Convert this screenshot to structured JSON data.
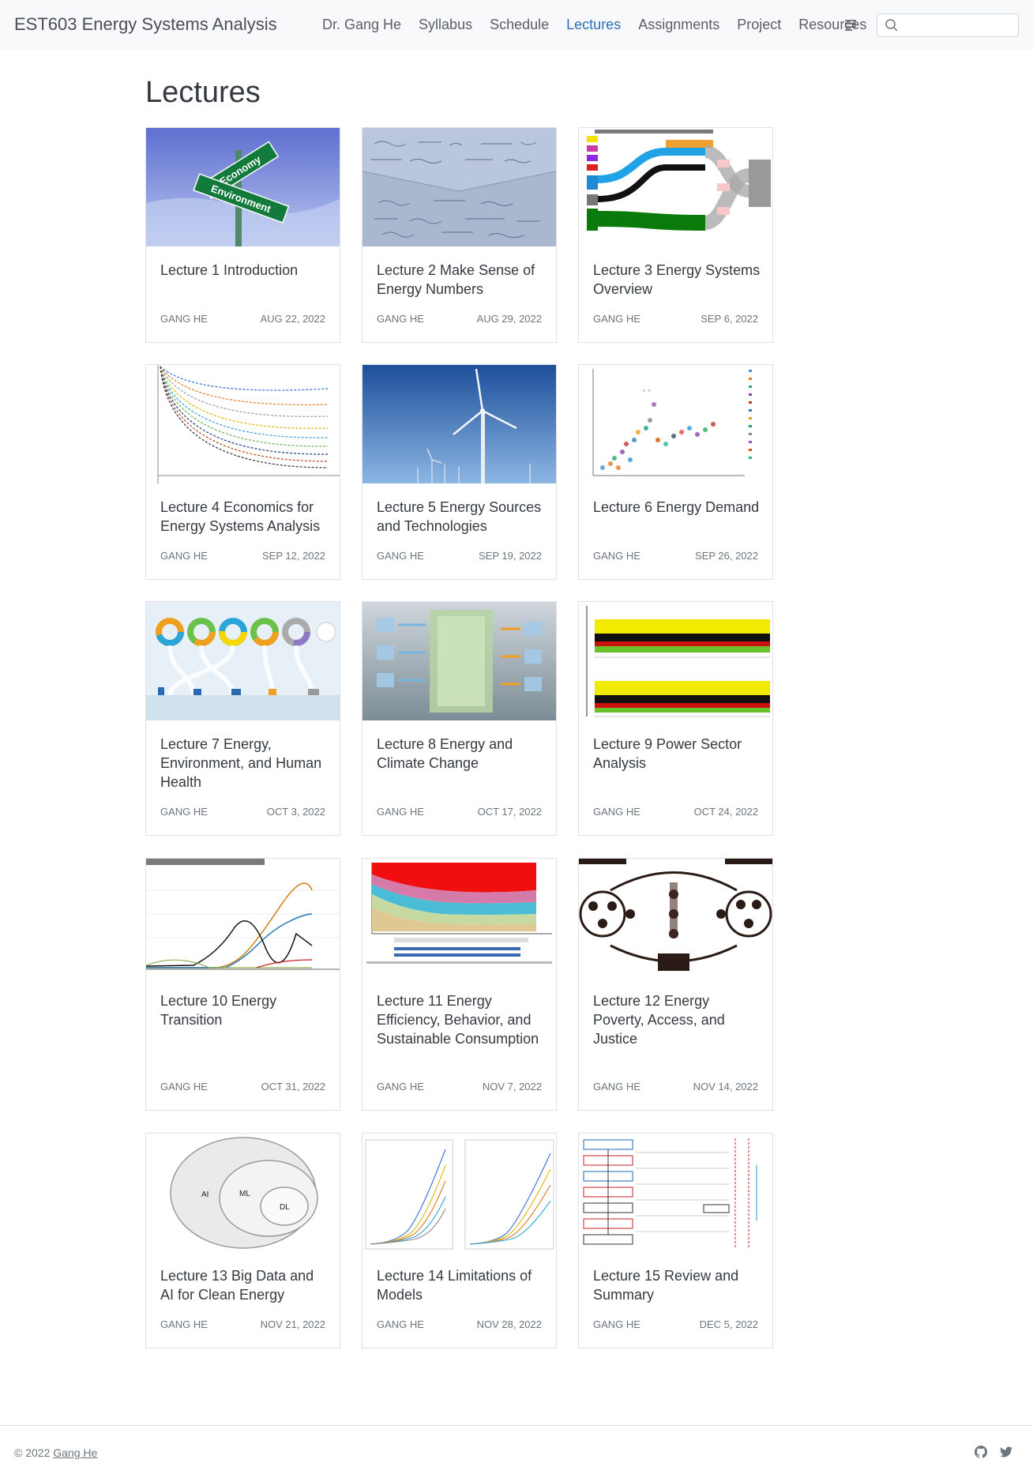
{
  "navbar": {
    "brand": "EST603 Energy Systems Analysis",
    "links": [
      "Dr. Gang He",
      "Syllabus",
      "Schedule",
      "Lectures",
      "Assignments",
      "Project",
      "Resources"
    ],
    "active": "Lectures",
    "search_placeholder": ""
  },
  "page": {
    "title": "Lectures"
  },
  "lectures": [
    {
      "title": "Lecture 1 Introduction",
      "author": "GANG HE",
      "date": "AUG 22, 2022",
      "thumb": "signpost-economy-environment"
    },
    {
      "title": "Lecture 2 Make Sense of Energy Numbers",
      "author": "GANG HE",
      "date": "AUG 29, 2022",
      "thumb": "handwritten-equations"
    },
    {
      "title": "Lecture 3 Energy Systems Overview",
      "author": "GANG HE",
      "date": "SEP 6, 2022",
      "thumb": "energy-flow-sankey"
    },
    {
      "title": "Lecture 4 Economics for Energy Systems Analysis",
      "author": "GANG HE",
      "date": "SEP 12, 2022",
      "thumb": "discount-curves"
    },
    {
      "title": "Lecture 5 Energy Sources and Technologies",
      "author": "GANG HE",
      "date": "SEP 19, 2022",
      "thumb": "offshore-wind-turbines"
    },
    {
      "title": "Lecture 6 Energy Demand",
      "author": "GANG HE",
      "date": "SEP 26, 2022",
      "thumb": "demand-scatter"
    },
    {
      "title": "Lecture 7 Energy, Environment, and Human Health",
      "author": "GANG HE",
      "date": "OCT 3, 2022",
      "thumb": "health-donuts"
    },
    {
      "title": "Lecture 8 Energy and Climate Change",
      "author": "GANG HE",
      "date": "OCT 17, 2022",
      "thumb": "climate-diagram"
    },
    {
      "title": "Lecture 9 Power Sector Analysis",
      "author": "GANG HE",
      "date": "OCT 24, 2022",
      "thumb": "dispatch-stack"
    },
    {
      "title": "Lecture 10 Energy Transition",
      "author": "GANG HE",
      "date": "OCT 31, 2022",
      "thumb": "us-consumption-history"
    },
    {
      "title": "Lecture 11 Energy Efficiency, Behavior, and Sustainable Consumption",
      "author": "GANG HE",
      "date": "NOV 7, 2022",
      "thumb": "efficiency-area"
    },
    {
      "title": "Lecture 12 Energy Poverty, Access, and Justice",
      "author": "GANG HE",
      "date": "NOV 14, 2022",
      "thumb": "justice-cycle"
    },
    {
      "title": "Lecture 13 Big Data and AI for Clean Energy",
      "author": "GANG HE",
      "date": "NOV 21, 2022",
      "thumb": "ai-ml-dl-venn"
    },
    {
      "title": "Lecture 14 Limitations of Models",
      "author": "GANG HE",
      "date": "NOV 28, 2022",
      "thumb": "model-projections"
    },
    {
      "title": "Lecture 15 Review and Summary",
      "author": "GANG HE",
      "date": "DEC 5, 2022",
      "thumb": "course-flowchart"
    }
  ],
  "thumb_text": {
    "economy": "Economy",
    "environment": "Environment",
    "ai": "AI",
    "ml": "ML",
    "dl": "DL"
  },
  "footer": {
    "copyright": "© 2022",
    "author_link": "Gang He"
  }
}
